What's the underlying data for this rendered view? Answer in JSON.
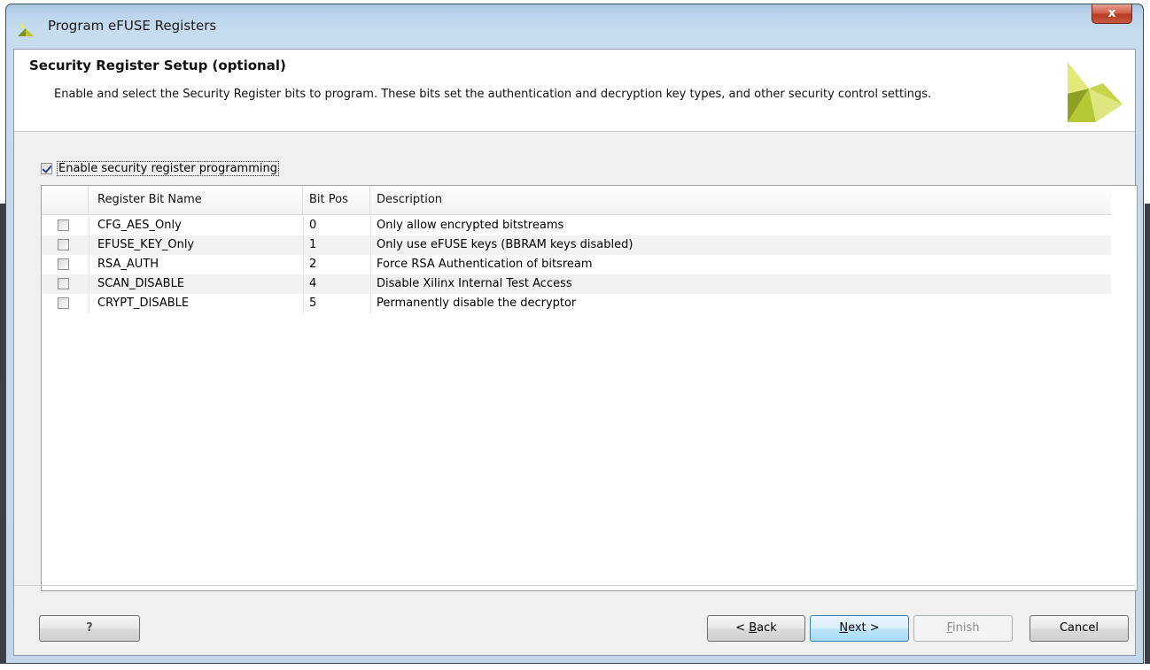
{
  "window": {
    "title": "Program eFUSE Registers",
    "close_label": "x"
  },
  "header": {
    "title": "Security Register Setup (optional)",
    "description": "Enable and select the Security Register bits to program. These bits set the authentication and decryption key types, and other security control settings."
  },
  "enable_checkbox": {
    "label": "Enable security register programming",
    "checked": true
  },
  "table": {
    "columns": [
      "",
      "Register Bit Name",
      "Bit Pos",
      "Description"
    ],
    "rows": [
      {
        "checked": false,
        "name": "CFG_AES_Only",
        "bit_pos": "0",
        "description": "Only allow encrypted bitstreams"
      },
      {
        "checked": false,
        "name": "EFUSE_KEY_Only",
        "bit_pos": "1",
        "description": "Only use eFUSE keys (BBRAM keys disabled)"
      },
      {
        "checked": false,
        "name": "RSA_AUTH",
        "bit_pos": "2",
        "description": "Force RSA Authentication of bitsream"
      },
      {
        "checked": false,
        "name": "SCAN_DISABLE",
        "bit_pos": "4",
        "description": "Disable Xilinx Internal Test Access"
      },
      {
        "checked": false,
        "name": "CRYPT_DISABLE",
        "bit_pos": "5",
        "description": "Permanently disable the decryptor"
      }
    ]
  },
  "buttons": {
    "help": "?",
    "back_prefix": "< ",
    "back_mnemonic": "B",
    "back_rest": "ack",
    "next_mnemonic": "N",
    "next_rest": "ext >",
    "finish_mnemonic": "F",
    "finish_rest": "inish",
    "cancel": "Cancel"
  },
  "colors": {
    "logo_primary": "#b5c934",
    "logo_secondary": "#e2e97a",
    "logo_dark": "#7e8f1e",
    "titlebar": "#bcd4ec",
    "next_button_accent": "#3c7fb1"
  },
  "icons": {
    "app_icon": "xilinx-logo-icon",
    "header_logo": "xilinx-logo-icon",
    "close": "close-icon"
  }
}
